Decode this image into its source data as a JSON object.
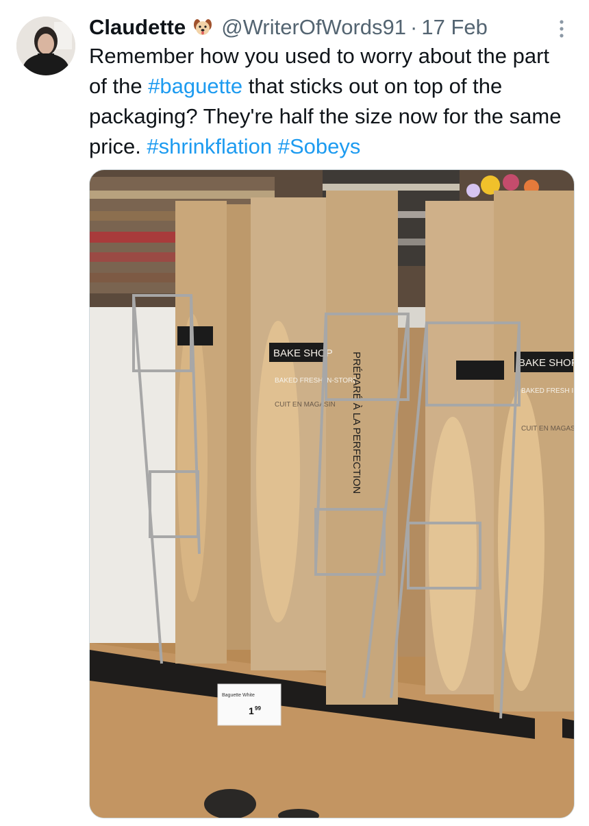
{
  "tweet": {
    "author": {
      "display_name": "Claudette",
      "emoji_icon": "dog-face-emoji",
      "handle": "@WriterOfWords91"
    },
    "separator": "·",
    "date": "17 Feb",
    "more_icon": "more-vertical-icon",
    "text": {
      "part1": "Remember how you used to worry about the part of the ",
      "hashtag1": "#baguette",
      "part2": " that sticks out on top of the packaging? They're half the size now for the same price. ",
      "hashtag2": "#shrinkflation",
      "space": " ",
      "hashtag3": "#Sobeys"
    },
    "photo": {
      "sign_text": "BAKE SHOP",
      "bag_text": "BAKED FRESH IN-STORE",
      "bag_text_fr": "CUIT EN MAGASIN",
      "vertical_text": "PRÉPARÉ À LA PERFECTION",
      "price_label": "Baguette White",
      "price": "1",
      "price_cents": "99"
    },
    "colors": {
      "hashtag": "#1d9bf0",
      "secondary_text": "#536471",
      "primary_text": "#0f1419"
    }
  }
}
